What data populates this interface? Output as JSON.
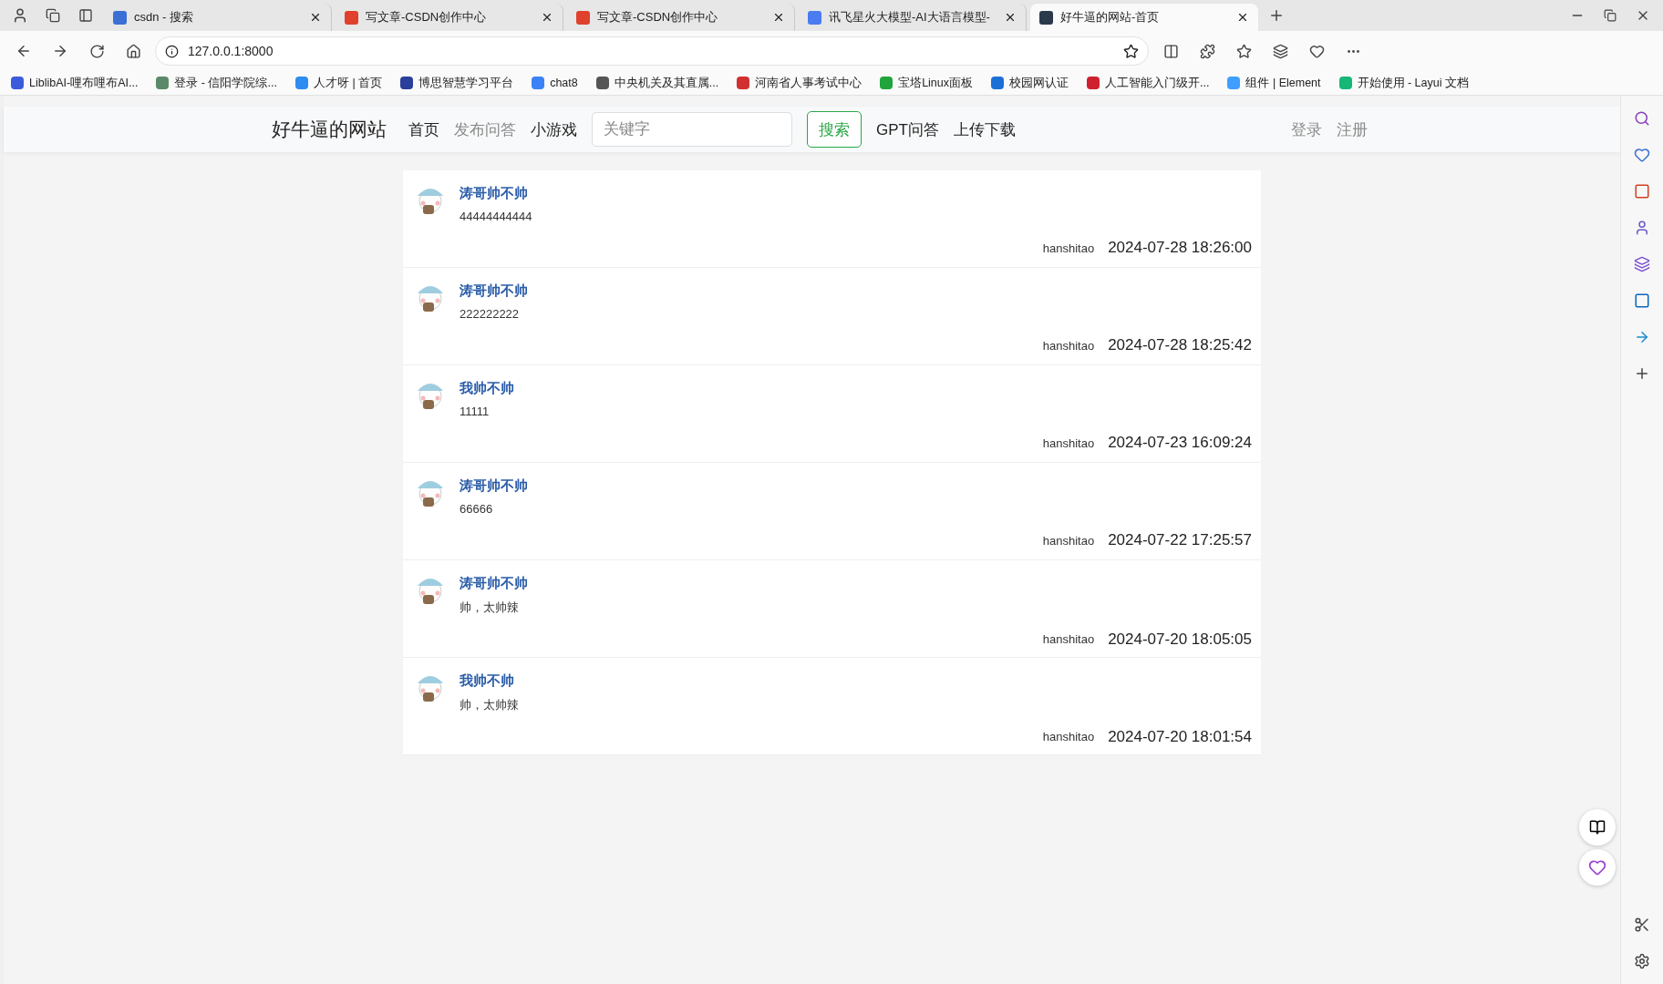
{
  "browser": {
    "tabs": [
      {
        "title": "csdn - 搜索",
        "selected": false,
        "color": "#3b6fd6"
      },
      {
        "title": "写文章-CSDN创作中心",
        "selected": false,
        "color": "#e0412c"
      },
      {
        "title": "写文章-CSDN创作中心",
        "selected": false,
        "color": "#e0412c"
      },
      {
        "title": "讯飞星火大模型-AI大语言模型-",
        "selected": false,
        "color": "#4a7bf0"
      },
      {
        "title": "好牛逼的网站-首页",
        "selected": true,
        "color": "#2b3a4a"
      }
    ],
    "url": "127.0.0.1:8000",
    "bookmarks": [
      {
        "label": "LiblibAI-哩布哩布AI...",
        "color": "#3b5bdb"
      },
      {
        "label": "登录 - 信阳学院综...",
        "color": "#5a8a6a"
      },
      {
        "label": "人才呀 | 首页",
        "color": "#2d8cf0"
      },
      {
        "label": "博思智慧学习平台",
        "color": "#2a3f9a"
      },
      {
        "label": "chat8",
        "color": "#3b82f6"
      },
      {
        "label": "中央机关及其直属...",
        "color": "#555555"
      },
      {
        "label": "河南省人事考试中心",
        "color": "#d03030"
      },
      {
        "label": "宝塔Linux面板",
        "color": "#20a53a"
      },
      {
        "label": "校园网认证",
        "color": "#1d6fd8"
      },
      {
        "label": "人工智能入门级开...",
        "color": "#cf2030"
      },
      {
        "label": "组件 | Element",
        "color": "#409eff"
      },
      {
        "label": "开始使用 - Layui 文档",
        "color": "#16b777"
      }
    ]
  },
  "site": {
    "brand": "好牛逼的网站",
    "nav": [
      {
        "label": "首页",
        "disabled": false
      },
      {
        "label": "发布问答",
        "disabled": true
      },
      {
        "label": "小游戏",
        "disabled": false
      }
    ],
    "search": {
      "placeholder": "关键字",
      "button": "搜索"
    },
    "nav_after": [
      {
        "label": "GPT问答",
        "disabled": false
      },
      {
        "label": "上传下载",
        "disabled": false
      }
    ],
    "account": [
      {
        "label": "登录"
      },
      {
        "label": "注册"
      }
    ]
  },
  "posts": [
    {
      "title": "涛哥帅不帅",
      "content": "44444444444",
      "author": "hanshitao",
      "time": "2024-07-28 18:26:00"
    },
    {
      "title": "涛哥帅不帅",
      "content": "222222222",
      "author": "hanshitao",
      "time": "2024-07-28 18:25:42"
    },
    {
      "title": "我帅不帅",
      "content": "11111",
      "author": "hanshitao",
      "time": "2024-07-23 16:09:24"
    },
    {
      "title": "涛哥帅不帅",
      "content": "66666",
      "author": "hanshitao",
      "time": "2024-07-22 17:25:57"
    },
    {
      "title": "涛哥帅不帅",
      "content": "帅，太帅辣",
      "author": "hanshitao",
      "time": "2024-07-20 18:05:05"
    },
    {
      "title": "我帅不帅",
      "content": "帅，太帅辣",
      "author": "hanshitao",
      "time": "2024-07-20 18:01:54"
    }
  ]
}
